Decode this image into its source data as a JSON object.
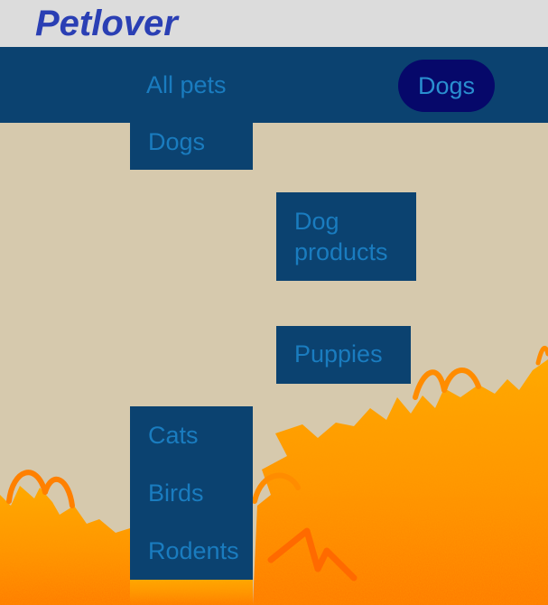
{
  "brand": {
    "name": "Petlover"
  },
  "nav": {
    "all_pets_label": "All pets",
    "active_pill_label": "Dogs"
  },
  "dropdown": {
    "dogs_label": "Dogs",
    "dog_products_label_line1": "Dog",
    "dog_products_label_line2": "products",
    "puppies_label": "Puppies",
    "cats_label": "Cats",
    "birds_label": "Birds",
    "rodents_label": "Rodents"
  },
  "colors": {
    "nav_bg": "#0b4270",
    "pill_bg": "#06086a",
    "link_text": "#1a7cbf",
    "logo_text": "#2a3fb4",
    "page_bg": "#d6c9ad",
    "decor_orange": "#ff9a00"
  },
  "icons": {
    "background_art": "orange-flames-illustration"
  }
}
